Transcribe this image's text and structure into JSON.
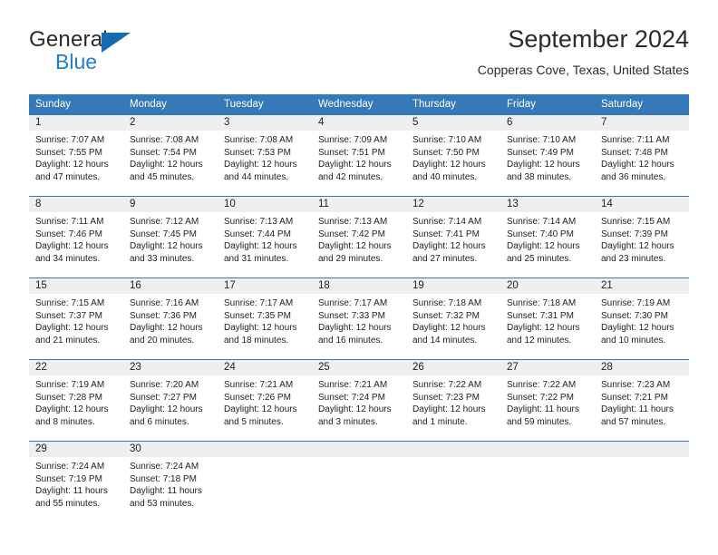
{
  "brand": {
    "name_top": "General",
    "name_bottom": "Blue",
    "triangle_color": "#1769b0",
    "blue_color": "#1f7fd0"
  },
  "header": {
    "title": "September 2024",
    "subtitle": "Copperas Cove, Texas, United States"
  },
  "theme": {
    "header_bg": "#3679b9",
    "daynum_bg": "#efefef",
    "rule_color": "#3679b9",
    "text_color": "#222222"
  },
  "weekday_headers": [
    "Sunday",
    "Monday",
    "Tuesday",
    "Wednesday",
    "Thursday",
    "Friday",
    "Saturday"
  ],
  "weeks": [
    [
      {
        "day": "1",
        "sunrise": "Sunrise: 7:07 AM",
        "sunset": "Sunset: 7:55 PM",
        "daylight1": "Daylight: 12 hours",
        "daylight2": "and 47 minutes."
      },
      {
        "day": "2",
        "sunrise": "Sunrise: 7:08 AM",
        "sunset": "Sunset: 7:54 PM",
        "daylight1": "Daylight: 12 hours",
        "daylight2": "and 45 minutes."
      },
      {
        "day": "3",
        "sunrise": "Sunrise: 7:08 AM",
        "sunset": "Sunset: 7:53 PM",
        "daylight1": "Daylight: 12 hours",
        "daylight2": "and 44 minutes."
      },
      {
        "day": "4",
        "sunrise": "Sunrise: 7:09 AM",
        "sunset": "Sunset: 7:51 PM",
        "daylight1": "Daylight: 12 hours",
        "daylight2": "and 42 minutes."
      },
      {
        "day": "5",
        "sunrise": "Sunrise: 7:10 AM",
        "sunset": "Sunset: 7:50 PM",
        "daylight1": "Daylight: 12 hours",
        "daylight2": "and 40 minutes."
      },
      {
        "day": "6",
        "sunrise": "Sunrise: 7:10 AM",
        "sunset": "Sunset: 7:49 PM",
        "daylight1": "Daylight: 12 hours",
        "daylight2": "and 38 minutes."
      },
      {
        "day": "7",
        "sunrise": "Sunrise: 7:11 AM",
        "sunset": "Sunset: 7:48 PM",
        "daylight1": "Daylight: 12 hours",
        "daylight2": "and 36 minutes."
      }
    ],
    [
      {
        "day": "8",
        "sunrise": "Sunrise: 7:11 AM",
        "sunset": "Sunset: 7:46 PM",
        "daylight1": "Daylight: 12 hours",
        "daylight2": "and 34 minutes."
      },
      {
        "day": "9",
        "sunrise": "Sunrise: 7:12 AM",
        "sunset": "Sunset: 7:45 PM",
        "daylight1": "Daylight: 12 hours",
        "daylight2": "and 33 minutes."
      },
      {
        "day": "10",
        "sunrise": "Sunrise: 7:13 AM",
        "sunset": "Sunset: 7:44 PM",
        "daylight1": "Daylight: 12 hours",
        "daylight2": "and 31 minutes."
      },
      {
        "day": "11",
        "sunrise": "Sunrise: 7:13 AM",
        "sunset": "Sunset: 7:42 PM",
        "daylight1": "Daylight: 12 hours",
        "daylight2": "and 29 minutes."
      },
      {
        "day": "12",
        "sunrise": "Sunrise: 7:14 AM",
        "sunset": "Sunset: 7:41 PM",
        "daylight1": "Daylight: 12 hours",
        "daylight2": "and 27 minutes."
      },
      {
        "day": "13",
        "sunrise": "Sunrise: 7:14 AM",
        "sunset": "Sunset: 7:40 PM",
        "daylight1": "Daylight: 12 hours",
        "daylight2": "and 25 minutes."
      },
      {
        "day": "14",
        "sunrise": "Sunrise: 7:15 AM",
        "sunset": "Sunset: 7:39 PM",
        "daylight1": "Daylight: 12 hours",
        "daylight2": "and 23 minutes."
      }
    ],
    [
      {
        "day": "15",
        "sunrise": "Sunrise: 7:15 AM",
        "sunset": "Sunset: 7:37 PM",
        "daylight1": "Daylight: 12 hours",
        "daylight2": "and 21 minutes."
      },
      {
        "day": "16",
        "sunrise": "Sunrise: 7:16 AM",
        "sunset": "Sunset: 7:36 PM",
        "daylight1": "Daylight: 12 hours",
        "daylight2": "and 20 minutes."
      },
      {
        "day": "17",
        "sunrise": "Sunrise: 7:17 AM",
        "sunset": "Sunset: 7:35 PM",
        "daylight1": "Daylight: 12 hours",
        "daylight2": "and 18 minutes."
      },
      {
        "day": "18",
        "sunrise": "Sunrise: 7:17 AM",
        "sunset": "Sunset: 7:33 PM",
        "daylight1": "Daylight: 12 hours",
        "daylight2": "and 16 minutes."
      },
      {
        "day": "19",
        "sunrise": "Sunrise: 7:18 AM",
        "sunset": "Sunset: 7:32 PM",
        "daylight1": "Daylight: 12 hours",
        "daylight2": "and 14 minutes."
      },
      {
        "day": "20",
        "sunrise": "Sunrise: 7:18 AM",
        "sunset": "Sunset: 7:31 PM",
        "daylight1": "Daylight: 12 hours",
        "daylight2": "and 12 minutes."
      },
      {
        "day": "21",
        "sunrise": "Sunrise: 7:19 AM",
        "sunset": "Sunset: 7:30 PM",
        "daylight1": "Daylight: 12 hours",
        "daylight2": "and 10 minutes."
      }
    ],
    [
      {
        "day": "22",
        "sunrise": "Sunrise: 7:19 AM",
        "sunset": "Sunset: 7:28 PM",
        "daylight1": "Daylight: 12 hours",
        "daylight2": "and 8 minutes."
      },
      {
        "day": "23",
        "sunrise": "Sunrise: 7:20 AM",
        "sunset": "Sunset: 7:27 PM",
        "daylight1": "Daylight: 12 hours",
        "daylight2": "and 6 minutes."
      },
      {
        "day": "24",
        "sunrise": "Sunrise: 7:21 AM",
        "sunset": "Sunset: 7:26 PM",
        "daylight1": "Daylight: 12 hours",
        "daylight2": "and 5 minutes."
      },
      {
        "day": "25",
        "sunrise": "Sunrise: 7:21 AM",
        "sunset": "Sunset: 7:24 PM",
        "daylight1": "Daylight: 12 hours",
        "daylight2": "and 3 minutes."
      },
      {
        "day": "26",
        "sunrise": "Sunrise: 7:22 AM",
        "sunset": "Sunset: 7:23 PM",
        "daylight1": "Daylight: 12 hours",
        "daylight2": "and 1 minute."
      },
      {
        "day": "27",
        "sunrise": "Sunrise: 7:22 AM",
        "sunset": "Sunset: 7:22 PM",
        "daylight1": "Daylight: 11 hours",
        "daylight2": "and 59 minutes."
      },
      {
        "day": "28",
        "sunrise": "Sunrise: 7:23 AM",
        "sunset": "Sunset: 7:21 PM",
        "daylight1": "Daylight: 11 hours",
        "daylight2": "and 57 minutes."
      }
    ],
    [
      {
        "day": "29",
        "sunrise": "Sunrise: 7:24 AM",
        "sunset": "Sunset: 7:19 PM",
        "daylight1": "Daylight: 11 hours",
        "daylight2": "and 55 minutes."
      },
      {
        "day": "30",
        "sunrise": "Sunrise: 7:24 AM",
        "sunset": "Sunset: 7:18 PM",
        "daylight1": "Daylight: 11 hours",
        "daylight2": "and 53 minutes."
      },
      {
        "day": "",
        "sunrise": "",
        "sunset": "",
        "daylight1": "",
        "daylight2": "",
        "empty": true
      },
      {
        "day": "",
        "sunrise": "",
        "sunset": "",
        "daylight1": "",
        "daylight2": "",
        "empty": true
      },
      {
        "day": "",
        "sunrise": "",
        "sunset": "",
        "daylight1": "",
        "daylight2": "",
        "empty": true
      },
      {
        "day": "",
        "sunrise": "",
        "sunset": "",
        "daylight1": "",
        "daylight2": "",
        "empty": true
      },
      {
        "day": "",
        "sunrise": "",
        "sunset": "",
        "daylight1": "",
        "daylight2": "",
        "empty": true
      }
    ]
  ]
}
